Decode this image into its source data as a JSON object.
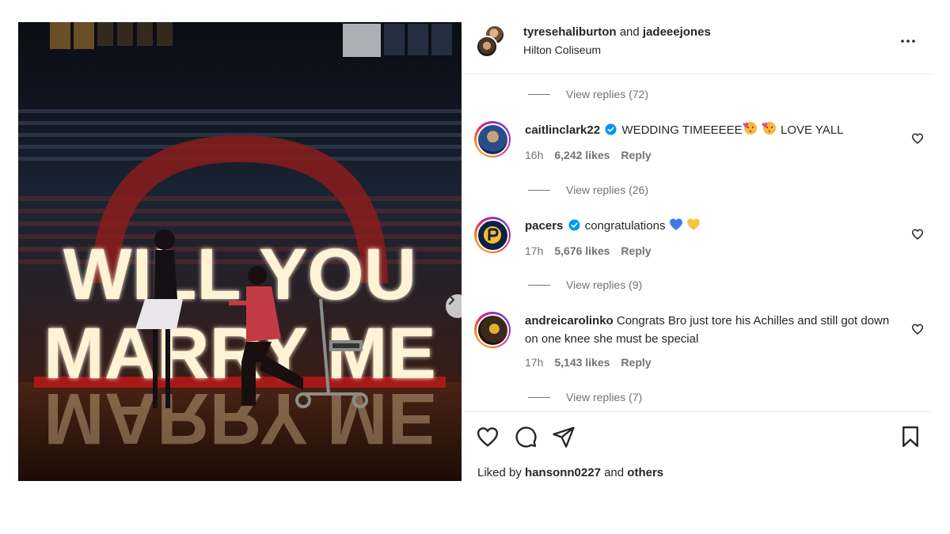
{
  "post": {
    "user_primary": "tyresehaliburton",
    "joiner": "and",
    "user_secondary": "jadeeejones",
    "location": "Hilton Coliseum"
  },
  "photo": {
    "sign_line1": "WILL YOU",
    "sign_line2": "MARRY ME"
  },
  "comments": [
    {
      "replies_label": "View replies (72)"
    },
    {
      "username": "caitlinclark22",
      "verified": true,
      "text": "WEDDING TIMEEEEE",
      "text_after": "LOVE YALL",
      "time": "16h",
      "likes": "6,242 likes",
      "reply": "Reply",
      "replies_label": "View replies (26)"
    },
    {
      "username": "pacers",
      "verified": true,
      "text": "congratulations",
      "time": "17h",
      "likes": "5,676 likes",
      "reply": "Reply",
      "replies_label": "View replies (9)"
    },
    {
      "username": "andreicarolinko",
      "verified": false,
      "text": "Congrats Bro just tore his Achilles and still got down on one knee she must be special",
      "time": "17h",
      "likes": "5,143 likes",
      "reply": "Reply",
      "replies_label": "View replies (7)"
    }
  ],
  "footer": {
    "liked_by_prefix": "Liked by",
    "liked_by_user": "hansonn0227",
    "liked_by_joiner": "and",
    "liked_by_others": "others"
  },
  "icons": {
    "more": "more-horizontal-icon",
    "like": "heart-icon",
    "comment": "comment-icon",
    "share": "send-icon",
    "save": "bookmark-icon",
    "next": "chevron-right-icon",
    "verified": "verified-badge-icon"
  },
  "colors": {
    "verified_blue": "#0095f6",
    "muted_text": "#737373",
    "text": "#262626",
    "divider": "#efefef"
  }
}
